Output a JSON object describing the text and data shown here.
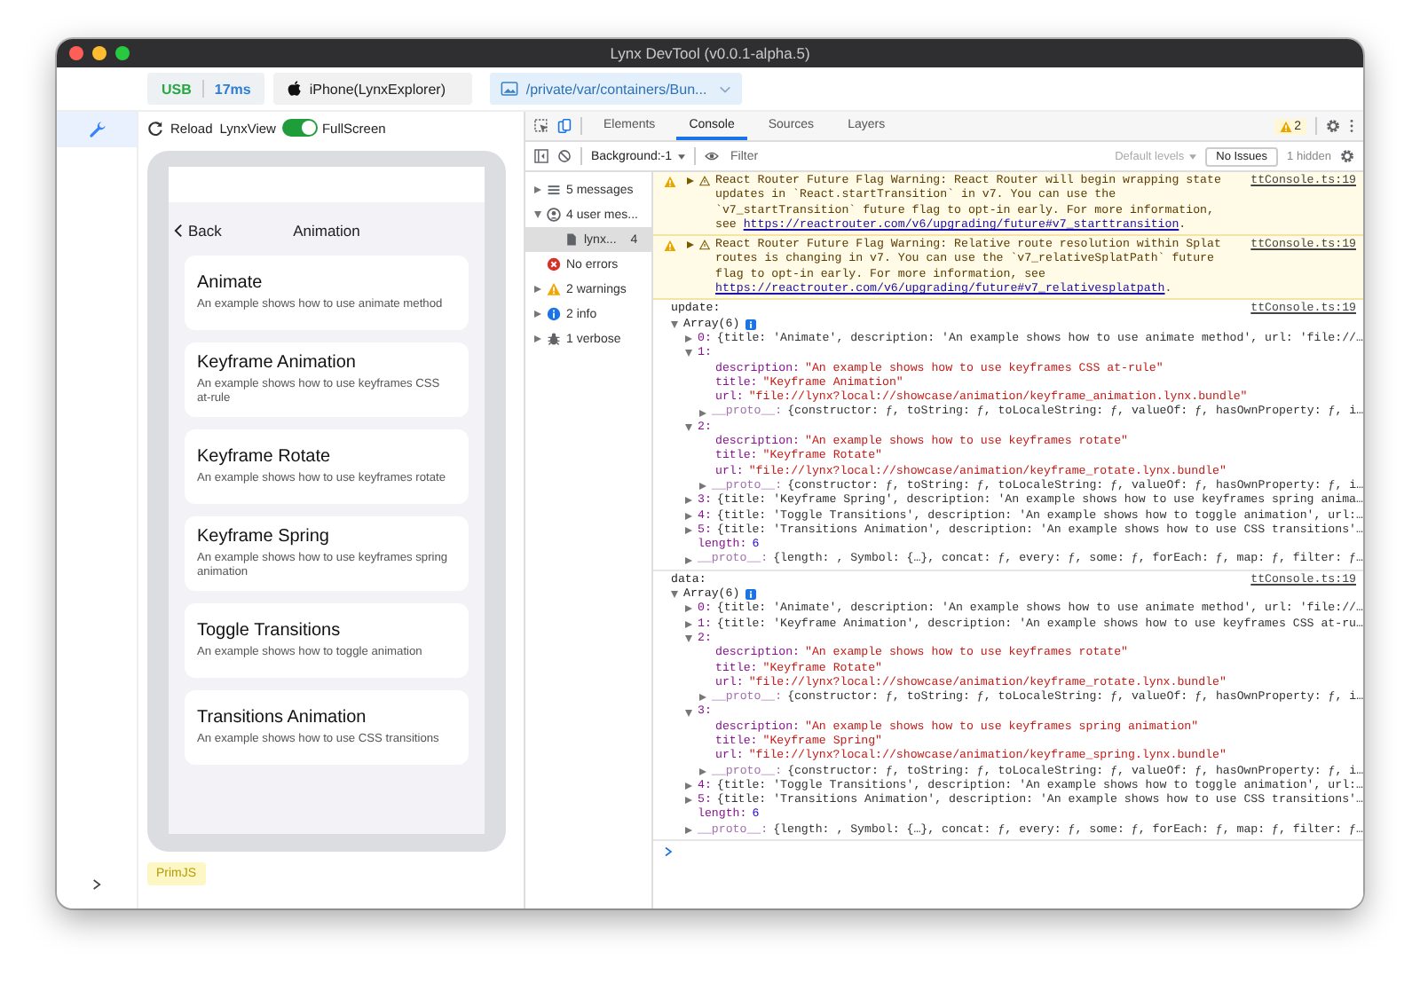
{
  "window": {
    "title": "Lynx DevTool (v0.0.1-alpha.5)"
  },
  "toolbar": {
    "connection_type": "USB",
    "latency": "17ms",
    "device": "iPhone(LynxExplorer)",
    "page_path": "/private/var/containers/Bun..."
  },
  "activity_bar": [
    {
      "selected": true
    }
  ],
  "preview": {
    "reload": "Reload",
    "lynxview": "LynxView",
    "fullscreen": {
      "label": "FullScreen",
      "on": true
    },
    "screen": {
      "back": "Back",
      "title": "Animation",
      "items": [
        {
          "title": "Animate",
          "description": "An example shows how to use animate method"
        },
        {
          "title": "Keyframe Animation",
          "description": "An example shows how to use keyframes CSS at-rule"
        },
        {
          "title": "Keyframe Rotate",
          "description": "An example shows how to use keyframes rotate"
        },
        {
          "title": "Keyframe Spring",
          "description": "An example shows how to use keyframes spring animation"
        },
        {
          "title": "Toggle Transitions",
          "description": "An example shows how to toggle animation"
        },
        {
          "title": "Transitions Animation",
          "description": "An example shows how to use CSS transitions"
        }
      ]
    },
    "engine": "PrimJS"
  },
  "devtools": {
    "tabs": [
      {
        "label": "Elements",
        "selected": false
      },
      {
        "label": "Console",
        "selected": true
      },
      {
        "label": "Sources",
        "selected": false
      },
      {
        "label": "Layers",
        "selected": false
      }
    ],
    "warning_count": "2",
    "console_toolbar": {
      "context": "Background:-1",
      "filter_placeholder": "Filter",
      "levels": "Default levels",
      "issues": "No Issues",
      "hidden": "1 hidden"
    },
    "sidebar": [
      {
        "kind": "messages",
        "label": "5 messages",
        "expanded": false,
        "selected": false
      },
      {
        "kind": "user",
        "label": "4 user mes...",
        "expanded": true,
        "selected": false,
        "children": [
          {
            "kind": "file",
            "label": "lynx...",
            "count": "4",
            "selected": true
          }
        ]
      },
      {
        "kind": "error",
        "label": "No errors",
        "selected": false
      },
      {
        "kind": "warning",
        "label": "2 warnings",
        "expanded": false,
        "selected": false
      },
      {
        "kind": "info",
        "label": "2 info",
        "expanded": false,
        "selected": false
      },
      {
        "kind": "verbose",
        "label": "1 verbose",
        "expanded": false,
        "selected": false
      }
    ],
    "messages": [
      {
        "kind": "warning",
        "expanded": false,
        "text": "React Router Future Flag Warning: React Router will begin wrapping state updates in `React.startTransition` in v7. You can use the `v7_startTransition` future flag to opt-in early. For more information, see ",
        "link": "https://reactrouter.com/v6/upgrading/future#v7_starttransition",
        "text_after": ".",
        "source": "ttConsole.ts:19"
      },
      {
        "kind": "warning",
        "expanded": false,
        "text": "React Router Future Flag Warning: Relative route resolution within Splat routes is changing in v7. You can use the `v7_relativeSplatPath` future flag to opt-in early. For more information, see ",
        "link": "https://reactrouter.com/v6/upgrading/future#v7_relativesplatpath",
        "text_after": ".",
        "source": "ttConsole.ts:19"
      },
      {
        "kind": "log",
        "label": "update:",
        "source": "ttConsole.ts:19",
        "value": {
          "kind": "array",
          "key": "Array(6)",
          "expanded": true,
          "children": [
            {
              "kind": "object",
              "key": "0:",
              "expanded": false,
              "summary": "{title: 'Animate', description: 'An example shows how to use animate method', url: 'file://…"
            },
            {
              "kind": "object",
              "key": "1:",
              "expanded": true,
              "children": [
                {
                  "kind": "string",
                  "key": "description:",
                  "value": "\"An example shows how to use keyframes CSS at-rule\""
                },
                {
                  "kind": "string",
                  "key": "title:",
                  "value": "\"Keyframe Animation\""
                },
                {
                  "kind": "string",
                  "key": "url:",
                  "value": "\"file://lynx?local://showcase/animation/keyframe_animation.lynx.bundle\""
                },
                {
                  "kind": "proto",
                  "key": "__proto__:",
                  "expanded": false,
                  "summary": "{constructor: ƒ, toString: ƒ, toLocaleString: ƒ, valueOf: ƒ, hasOwnProperty: ƒ, i…"
                }
              ]
            },
            {
              "kind": "object",
              "key": "2:",
              "expanded": true,
              "children": [
                {
                  "kind": "string",
                  "key": "description:",
                  "value": "\"An example shows how to use keyframes rotate\""
                },
                {
                  "kind": "string",
                  "key": "title:",
                  "value": "\"Keyframe Rotate\""
                },
                {
                  "kind": "string",
                  "key": "url:",
                  "value": "\"file://lynx?local://showcase/animation/keyframe_rotate.lynx.bundle\""
                },
                {
                  "kind": "proto",
                  "key": "__proto__:",
                  "expanded": false,
                  "summary": "{constructor: ƒ, toString: ƒ, toLocaleString: ƒ, valueOf: ƒ, hasOwnProperty: ƒ, i…"
                }
              ]
            },
            {
              "kind": "object",
              "key": "3:",
              "expanded": false,
              "summary": "{title: 'Keyframe Spring', description: 'An example shows how to use keyframes spring anima…"
            },
            {
              "kind": "object",
              "key": "4:",
              "expanded": false,
              "summary": "{title: 'Toggle Transitions', description: 'An example shows how to toggle animation', url:…"
            },
            {
              "kind": "object",
              "key": "5:",
              "expanded": false,
              "summary": "{title: 'Transitions Animation', description: 'An example shows how to use CSS transitions'…"
            },
            {
              "kind": "number",
              "key": "length:",
              "value": "6"
            },
            {
              "kind": "proto",
              "key": "__proto__:",
              "expanded": false,
              "summary": "{length: , Symbol: {…}, concat: ƒ, every: ƒ, some: ƒ, forEach: ƒ, map: ƒ, filter: ƒ…"
            }
          ]
        }
      },
      {
        "kind": "log",
        "label": "data:",
        "source": "ttConsole.ts:19",
        "value": {
          "kind": "array",
          "key": "Array(6)",
          "expanded": true,
          "children": [
            {
              "kind": "object",
              "key": "0:",
              "expanded": false,
              "summary": "{title: 'Animate', description: 'An example shows how to use animate method', url: 'file://…"
            },
            {
              "kind": "object",
              "key": "1:",
              "expanded": false,
              "summary": "{title: 'Keyframe Animation', description: 'An example shows how to use keyframes CSS at-ru…"
            },
            {
              "kind": "object",
              "key": "2:",
              "expanded": true,
              "children": [
                {
                  "kind": "string",
                  "key": "description:",
                  "value": "\"An example shows how to use keyframes rotate\""
                },
                {
                  "kind": "string",
                  "key": "title:",
                  "value": "\"Keyframe Rotate\""
                },
                {
                  "kind": "string",
                  "key": "url:",
                  "value": "\"file://lynx?local://showcase/animation/keyframe_rotate.lynx.bundle\""
                },
                {
                  "kind": "proto",
                  "key": "__proto__:",
                  "expanded": false,
                  "summary": "{constructor: ƒ, toString: ƒ, toLocaleString: ƒ, valueOf: ƒ, hasOwnProperty: ƒ, i…"
                }
              ]
            },
            {
              "kind": "object",
              "key": "3:",
              "expanded": true,
              "children": [
                {
                  "kind": "string",
                  "key": "description:",
                  "value": "\"An example shows how to use keyframes spring animation\""
                },
                {
                  "kind": "string",
                  "key": "title:",
                  "value": "\"Keyframe Spring\""
                },
                {
                  "kind": "string",
                  "key": "url:",
                  "value": "\"file://lynx?local://showcase/animation/keyframe_spring.lynx.bundle\""
                },
                {
                  "kind": "proto",
                  "key": "__proto__:",
                  "expanded": false,
                  "summary": "{constructor: ƒ, toString: ƒ, toLocaleString: ƒ, valueOf: ƒ, hasOwnProperty: ƒ, i…"
                }
              ]
            },
            {
              "kind": "object",
              "key": "4:",
              "expanded": false,
              "summary": "{title: 'Toggle Transitions', description: 'An example shows how to toggle animation', url:…"
            },
            {
              "kind": "object",
              "key": "5:",
              "expanded": false,
              "summary": "{title: 'Transitions Animation', description: 'An example shows how to use CSS transitions'…"
            },
            {
              "kind": "number",
              "key": "length:",
              "value": "6"
            },
            {
              "kind": "proto",
              "key": "__proto__:",
              "expanded": false,
              "summary": "{length: , Symbol: {…}, concat: ƒ, every: ƒ, some: ƒ, forEach: ƒ, map: ƒ, filter: ƒ…"
            }
          ]
        }
      }
    ]
  }
}
